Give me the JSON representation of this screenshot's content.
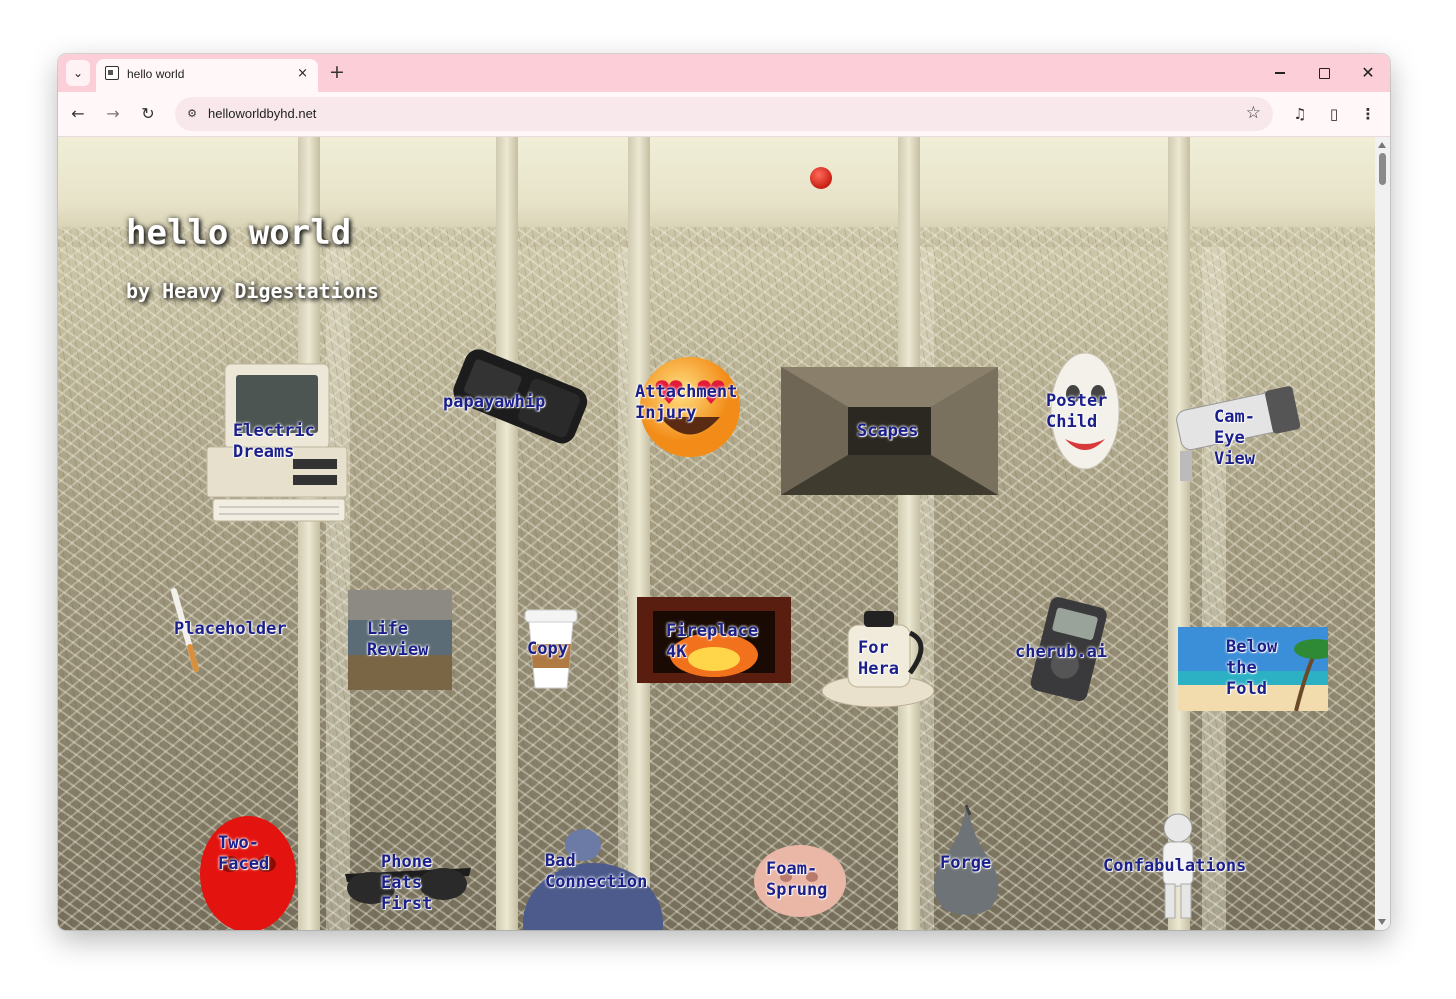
{
  "browser": {
    "tab_title": "hello world",
    "url": "helloworldbyhd.net",
    "new_tab_label": "+",
    "tab_close_label": "×"
  },
  "page": {
    "title": "hello world",
    "subtitle": "by Heavy Digestations"
  },
  "items": [
    {
      "label": "Electric\nDreams",
      "icon": "vintage-computer-icon"
    },
    {
      "label": "papayawhip",
      "icon": "flip-phone-icon"
    },
    {
      "label": "Attachment\nInjury",
      "icon": "heart-eyes-emoji-icon"
    },
    {
      "label": "Scapes",
      "icon": "tunnel-photo"
    },
    {
      "label": "Poster\nChild",
      "icon": "hockey-mask-icon"
    },
    {
      "label": "Cam-\nEye\nView",
      "icon": "security-camera-icon"
    },
    {
      "label": "Placeholder",
      "icon": "cigarette-icon"
    },
    {
      "label": "Life\nReview",
      "icon": "empty-room-photo"
    },
    {
      "label": "Copy",
      "icon": "coffee-cup-icon"
    },
    {
      "label": "Fireplace\n4K",
      "icon": "fireplace-photo"
    },
    {
      "label": "For\nHera",
      "icon": "kettle-icon"
    },
    {
      "label": "cherub.ai",
      "icon": "pager-device-icon"
    },
    {
      "label": "Below\nthe\nFold",
      "icon": "beach-photo"
    },
    {
      "label": "Two-\nFaced",
      "icon": "red-led-mask-icon"
    },
    {
      "label": "Phone\nEats\nFirst",
      "icon": "sunglasses-icon"
    },
    {
      "label": "Bad\nConnection",
      "icon": "pigeon-icon"
    },
    {
      "label": "Foam-\nSprung",
      "icon": "foam-head-icon"
    },
    {
      "label": "Forge",
      "icon": "metal-pear-icon"
    },
    {
      "label": "Confabulations",
      "icon": "astronaut-icon"
    }
  ],
  "colors": {
    "tab_strip": "#fccfd8",
    "toolbar": "#fff7f8",
    "link_label": "#1b1f8a"
  }
}
